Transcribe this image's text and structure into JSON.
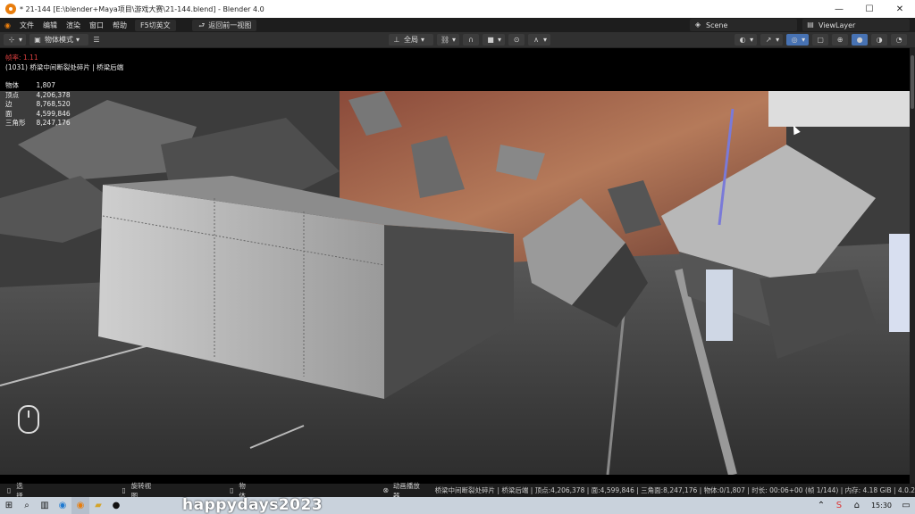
{
  "window": {
    "title": "* 21-144 [E:\\blender+Maya项目\\游戏大赛\\21-144.blend] - Blender 4.0",
    "min": "—",
    "max": "☐",
    "close": "✕"
  },
  "menu": {
    "items": [
      "文件",
      "编辑",
      "渲染",
      "窗口",
      "帮助"
    ],
    "f5_button": "F5切英文",
    "back_button": "返回前一视图",
    "scene_label": "Scene",
    "viewlayer_label": "ViewLayer"
  },
  "header": {
    "mode": "物体模式",
    "transform": "全局"
  },
  "overlay": {
    "fps_label": "帧率:",
    "fps_value": "1.11",
    "object_info": "(1031) 桥梁中间断裂处碎片 | 桥梁后端",
    "stats": [
      {
        "label": "物体",
        "value": "1,807"
      },
      {
        "label": "顶点",
        "value": "4,206,378"
      },
      {
        "label": "边",
        "value": "8,768,520"
      },
      {
        "label": "面",
        "value": "4,599,846"
      },
      {
        "label": "三角形",
        "value": "8,247,176"
      }
    ]
  },
  "status": {
    "select": "选择",
    "rotate": "旋转视图",
    "object": "物体",
    "anim_player": "动画播放器",
    "info": "桥梁中间断裂处碎片 | 桥梁后端 | 顶点:4,206,378 | 面:4,599,846 | 三角面:8,247,176 | 物体:0/1,807 | 时长: 00:06+00 (帧 1/144) | 内存: 4.18 GiB | 4.0.2"
  },
  "taskbar": {
    "time": "15:30",
    "watermark": "happydays2023"
  },
  "colors": {
    "accent": "#e87d0d",
    "fps": "#e04040"
  }
}
